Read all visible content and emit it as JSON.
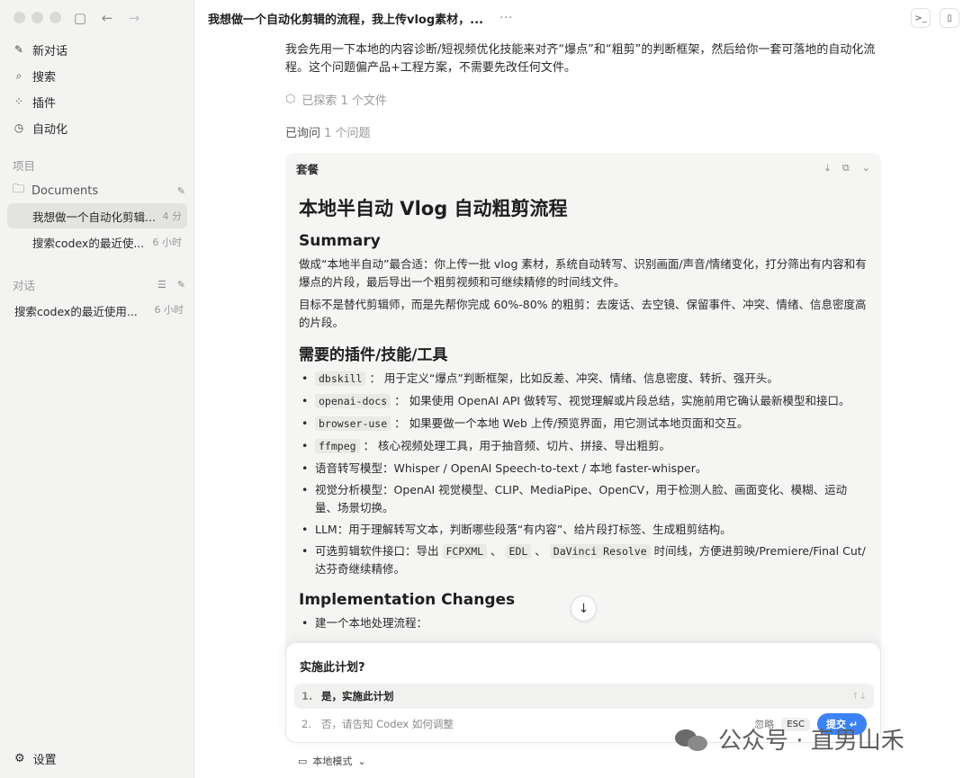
{
  "sidebar": {
    "nav": [
      {
        "icon": "edit-icon",
        "glyph": "✎",
        "label": "新对话"
      },
      {
        "icon": "search-icon",
        "glyph": "⌕",
        "label": "搜索"
      },
      {
        "icon": "plugins-icon",
        "glyph": "⁘",
        "label": "插件"
      },
      {
        "icon": "clock-icon",
        "glyph": "◷",
        "label": "自动化"
      }
    ],
    "projects_label": "项目",
    "folder_label": "Documents",
    "threads": [
      {
        "title": "我想做一个自动化剪辑...",
        "ago": "4 分"
      },
      {
        "title": "搜索codex的最近使...",
        "ago": "6 小时"
      }
    ],
    "chats_label": "对话",
    "chat_item": {
      "title": "搜索codex的最近使用...",
      "ago": "6 小时"
    },
    "settings_label": "设置"
  },
  "header": {
    "title": "我想做一个自动化剪辑的流程，我上传vlog素材，...",
    "more": "···"
  },
  "main": {
    "intro": "我会先用一下本地的内容诊断/短视频优化技能来对齐“爆点”和“粗剪”的判断框架，然后给你一套可落地的自动化流程。这个问题偏产品+工程方案，不需要先改任何文件。",
    "explored": "已探索 1 个文件",
    "asked_prefix": "已询问",
    "asked_suffix": "1 个问题"
  },
  "plan": {
    "header": "套餐",
    "title": "本地半自动 Vlog 自动粗剪流程",
    "summary_heading": "Summary",
    "summary_p1": "做成“本地半自动”最合适：你上传一批 vlog 素材，系统自动转写、识别画面/声音/情绪变化，打分筛出有内容和有爆点的片段，最后导出一个粗剪视频和可继续精修的时间线文件。",
    "summary_p2": "目标不是替代剪辑师，而是先帮你完成 60%-80% 的粗剪：去废话、去空镜、保留事件、冲突、情绪、信息密度高的片段。",
    "tools_heading": "需要的插件/技能/工具",
    "tools": [
      {
        "code": "dbskill",
        "text": "： 用于定义“爆点”判断框架，比如反差、冲突、情绪、信息密度、转折、强开头。"
      },
      {
        "code": "openai-docs",
        "text": "： 如果使用 OpenAI API 做转写、视觉理解或片段总结，实施前用它确认最新模型和接口。"
      },
      {
        "code": "browser-use",
        "text": "： 如果要做一个本地 Web 上传/预览界面，用它测试本地页面和交互。"
      },
      {
        "code": "ffmpeg",
        "text": "： 核心视频处理工具，用于抽音频、切片、拼接、导出粗剪。"
      },
      {
        "code": "",
        "text": "语音转写模型：Whisper / OpenAI Speech-to-text / 本地 faster-whisper。"
      },
      {
        "code": "",
        "text": "视觉分析模型：OpenAI 视觉模型、CLIP、MediaPipe、OpenCV，用于检测人脸、画面变化、模糊、运动量、场景切换。"
      },
      {
        "code": "",
        "text": "LLM：用于理解转写文本，判断哪些段落“有内容”、给片段打标签、生成粗剪结构。"
      }
    ],
    "export_item": {
      "prefix": "可选剪辑软件接口：导出",
      "c1": "FCPXML",
      "sep1": "、",
      "c2": "EDL",
      "sep2": "、",
      "c3": "DaVinci Resolve",
      "suffix": "时间线，方便进剪映/Premiere/Final Cut/达芬奇继续精修。"
    },
    "impl_heading": "Implementation Changes",
    "impl_first": "建一个本地处理流程："
  },
  "confirm": {
    "question": "实施此计划?",
    "opt1_num": "1.",
    "opt1": "是，实施此计划",
    "opt1_arrows": "↑↓",
    "opt2_num": "2.",
    "opt2": "否，请告知 Codex 如何调整",
    "ignore": "忽略",
    "esc": "ESC",
    "submit": "提交 ↵"
  },
  "footer": {
    "mode": "本地模式",
    "watermark": "公众号 · 直男山禾"
  }
}
